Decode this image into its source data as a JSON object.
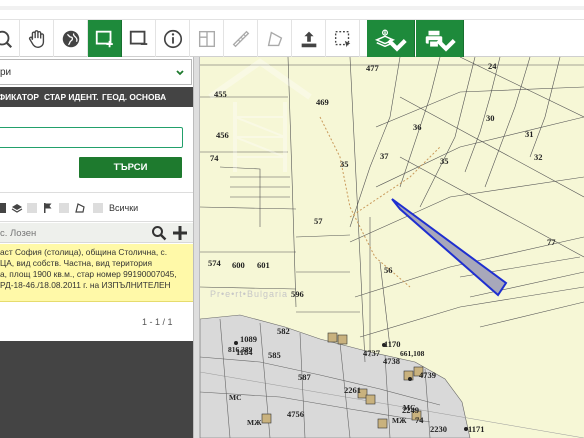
{
  "panel": {
    "layer_select": "ри",
    "tabs": [
      "ФИКАТОР",
      "СТАР ИДЕНТ.",
      "ГЕОД. ОСНОВА"
    ],
    "search_value": "",
    "search_button": "ТЪРСИ",
    "filter_all": "Всички",
    "result_filter": "с. Лозен",
    "result_lines": [
      "аст София (столица), община Столична, с.",
      "ЦА, вид собств. Частна, вид територия",
      "а, площ 1900 кв.м., стар номер 99190007045,",
      "РД-18-46./18.08.2011 г. на ИЗПЪЛНИТЕЛЕН"
    ],
    "pager": "1 - 1 / 1"
  },
  "map": {
    "parcel_labels": [
      {
        "t": "477"
      },
      {
        "t": "24"
      },
      {
        "t": "455"
      },
      {
        "t": "469"
      },
      {
        "t": "36"
      },
      {
        "t": "30"
      },
      {
        "t": "31"
      },
      {
        "t": "456"
      },
      {
        "t": "37"
      },
      {
        "t": "35"
      },
      {
        "t": "32"
      },
      {
        "t": "74"
      },
      {
        "t": "35"
      },
      {
        "t": "57"
      },
      {
        "t": "77"
      },
      {
        "t": "574"
      },
      {
        "t": "600"
      },
      {
        "t": "601"
      },
      {
        "t": "56"
      },
      {
        "t": "596"
      },
      {
        "t": "582"
      },
      {
        "t": "1089"
      },
      {
        "t": "585"
      },
      {
        "t": "587"
      },
      {
        "t": "1170"
      },
      {
        "t": "661,108"
      },
      {
        "t": "4737"
      },
      {
        "t": "4738"
      },
      {
        "t": "4739"
      },
      {
        "t": "2261"
      },
      {
        "t": "4756"
      },
      {
        "t": "2249"
      },
      {
        "t": "74"
      },
      {
        "t": "2230"
      },
      {
        "t": "1171"
      },
      {
        "t": "1184"
      },
      {
        "t": "816,389"
      },
      {
        "t": "МС"
      },
      {
        "t": "МЖ"
      },
      {
        "t": "МС"
      },
      {
        "t": "МЖ"
      }
    ],
    "watermark": "Pr•e•rt•Bulgaria"
  },
  "colors": {
    "accent": "#1e8a3b",
    "selected_parcel": "#1f2fd0",
    "map_bg": "#f6f7d6"
  }
}
